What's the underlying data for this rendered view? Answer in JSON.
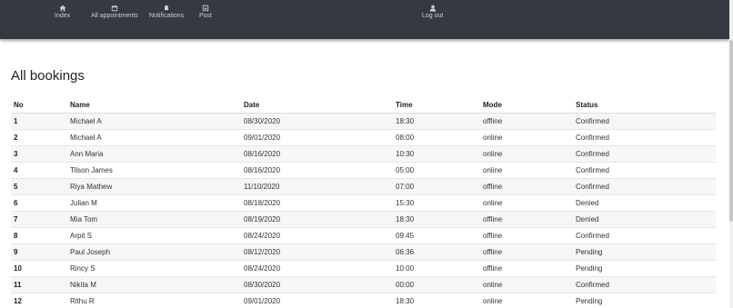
{
  "nav": {
    "index": {
      "label": "Index",
      "icon": "home-icon"
    },
    "appointments": {
      "label": "All appointments",
      "icon": "calendar-icon"
    },
    "notifications": {
      "label": "Notifications",
      "icon": "bell-icon"
    },
    "post": {
      "label": "Post",
      "icon": "post-icon"
    },
    "logout": {
      "label": "Log out",
      "icon": "user-icon"
    }
  },
  "page_title": "All bookings",
  "table": {
    "headers": {
      "no": "No",
      "name": "Name",
      "date": "Date",
      "time": "Time",
      "mode": "Mode",
      "status": "Status"
    },
    "rows": [
      {
        "no": "1",
        "name": "Michael A",
        "date": "08/30/2020",
        "time": "18:30",
        "mode": "offline",
        "status": "Confirmed"
      },
      {
        "no": "2",
        "name": "Michael A",
        "date": "09/01/2020",
        "time": "08:00",
        "mode": "online",
        "status": "Confirmed"
      },
      {
        "no": "3",
        "name": "Ann Maria",
        "date": "08/16/2020",
        "time": "10:30",
        "mode": "online",
        "status": "Confirmed"
      },
      {
        "no": "4",
        "name": "Tilson James",
        "date": "08/16/2020",
        "time": "05:00",
        "mode": "online",
        "status": "Confirmed"
      },
      {
        "no": "5",
        "name": "Riya Mathew",
        "date": "11/10/2020",
        "time": "07:00",
        "mode": "offline",
        "status": "Confirmed"
      },
      {
        "no": "6",
        "name": "Julian M",
        "date": "08/18/2020",
        "time": "15:30",
        "mode": "online",
        "status": "Denied"
      },
      {
        "no": "7",
        "name": "Mia Tom",
        "date": "08/19/2020",
        "time": "18:30",
        "mode": "offline",
        "status": "Denied"
      },
      {
        "no": "8",
        "name": "Arpit S",
        "date": "08/24/2020",
        "time": "09:45",
        "mode": "offline",
        "status": "Confirmed"
      },
      {
        "no": "9",
        "name": "Paul Joseph",
        "date": "08/12/2020",
        "time": "06:36",
        "mode": "offline",
        "status": "Pending"
      },
      {
        "no": "10",
        "name": "Rincy S",
        "date": "08/24/2020",
        "time": "10:00",
        "mode": "offline",
        "status": "Pending"
      },
      {
        "no": "11",
        "name": "Nikita M",
        "date": "08/30/2020",
        "time": "00:00",
        "mode": "online",
        "status": "Confirmed"
      },
      {
        "no": "12",
        "name": "Rithu R",
        "date": "09/01/2020",
        "time": "18:30",
        "mode": "online",
        "status": "Pending"
      }
    ]
  },
  "colors": {
    "navbar_bg": "#343a40",
    "nav_text": "#c9ced3",
    "stripe": "#f6f6f6"
  }
}
